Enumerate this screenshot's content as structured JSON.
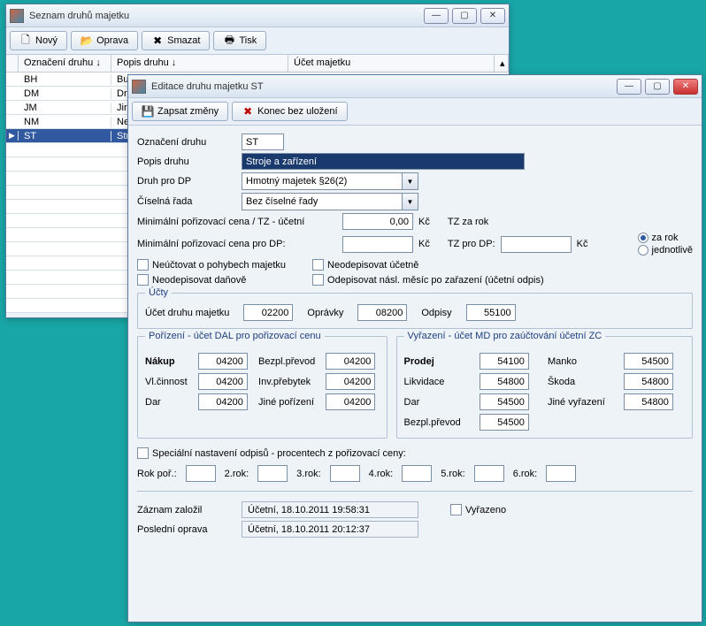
{
  "listWindow": {
    "title": "Seznam druhů majetku",
    "toolbar": {
      "novy": "Nový",
      "oprava": "Oprava",
      "smazat": "Smazat",
      "tisk": "Tisk"
    },
    "headers": {
      "oznaceni": "Označení druhu",
      "popis": "Popis druhu",
      "ucet": "Účet majetku"
    },
    "sortArrow": "↓",
    "rows": [
      {
        "code": "BH",
        "popis": "Bu"
      },
      {
        "code": "DM",
        "popis": "Dr"
      },
      {
        "code": "JM",
        "popis": "Jir"
      },
      {
        "code": "NM",
        "popis": "Ne"
      },
      {
        "code": "ST",
        "popis": "Str",
        "selected": true
      }
    ]
  },
  "editWindow": {
    "title": "Editace druhu majetku ST",
    "toolbar": {
      "zapsat": "Zapsat změny",
      "konec": "Konec bez uložení"
    },
    "labels": {
      "oznaceni": "Označení druhu",
      "popis": "Popis druhu",
      "druhDP": "Druh pro DP",
      "ciselna": "Číselná řada",
      "minTZucetni": "Minimální pořizovací cena / TZ - účetní",
      "minDP": "Minimální pořizovací cena pro DP:",
      "kc": "Kč",
      "tzZaRok": "TZ za rok",
      "tzProDP": "TZ pro DP:",
      "zaRok": "za rok",
      "jednotlive": "jednotlivě"
    },
    "values": {
      "oznaceni": "ST",
      "popis": "Stroje a zařízení",
      "druhDP": "Hmotný majetek §26(2)",
      "ciselna": "Bez číselné řady",
      "minTZucetni": "0,00",
      "minDP": "",
      "tzProDP": ""
    },
    "checks": {
      "neuctovat": "Neúčtovat o pohybech majetku",
      "neodepDan": "Neodepisovat daňově",
      "neodepUcet": "Neodepisovat účetně",
      "odepNasl": "Odepisovat násl. měsíc po zařazení (účetní odpis)"
    },
    "ucty": {
      "legend": "Účty",
      "druh": "Účet druhu majetku",
      "druhVal": "02200",
      "opravky": "Oprávky",
      "opravkyVal": "08200",
      "odpisy": "Odpisy",
      "odpisyVal": "55100"
    },
    "porizeni": {
      "legend": "Pořízení - účet DAL pro pořizovací cenu",
      "items": [
        {
          "l": "Nákup",
          "v": "04200",
          "bold": true
        },
        {
          "l": "Bezpl.převod",
          "v": "04200"
        },
        {
          "l": "Vl.činnost",
          "v": "04200"
        },
        {
          "l": "Inv.přebytek",
          "v": "04200"
        },
        {
          "l": "Dar",
          "v": "04200"
        },
        {
          "l": "Jiné pořízení",
          "v": "04200"
        }
      ]
    },
    "vyrazeni": {
      "legend": "Vyřazení - účet MD pro zaúčtování účetní ZC",
      "items": [
        {
          "l": "Prodej",
          "v": "54100",
          "bold": true
        },
        {
          "l": "Manko",
          "v": "54500"
        },
        {
          "l": "Likvidace",
          "v": "54800"
        },
        {
          "l": "Škoda",
          "v": "54800"
        },
        {
          "l": "Dar",
          "v": "54500"
        },
        {
          "l": "Jiné vyřazení",
          "v": "54800"
        },
        {
          "l": "Bezpl.převod",
          "v": "54500"
        }
      ]
    },
    "special": {
      "label": "Speciální nastavení odpisů - procentech z pořizovací ceny:",
      "rokPor": "Rok poř.:",
      "r2": "2.rok:",
      "r3": "3.rok:",
      "r4": "4.rok:",
      "r5": "5.rok:",
      "r6": "6.rok:"
    },
    "footer": {
      "zalozil": "Záznam založil",
      "zalozilVal": "Účetní, 18.10.2011 19:58:31",
      "oprava": "Poslední oprava",
      "opravaVal": "Účetní, 18.10.2011 20:12:37",
      "vyrazeno": "Vyřazeno"
    }
  }
}
